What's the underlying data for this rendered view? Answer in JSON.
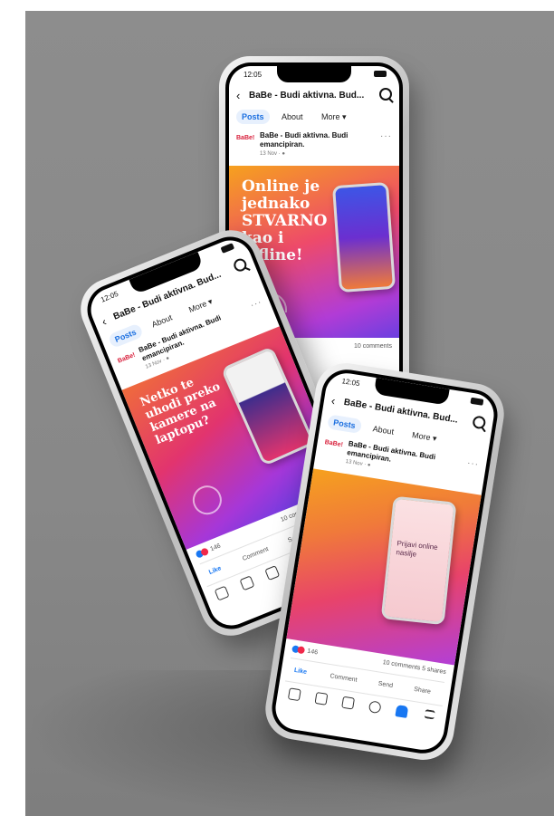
{
  "status": {
    "time": "12:05"
  },
  "page_name": "BaBe - Budi aktivna. Bud...",
  "tabs": [
    "Posts",
    "About",
    "More ▾"
  ],
  "post": {
    "author": "BaBe - Budi aktivna. Budi emancipiran.",
    "logo_text": "BaBe!",
    "meta": "13 Nov · ●"
  },
  "creatives": {
    "back": "Online je jednako STVARNO kao i offline!",
    "left": "Netko te uhodi preko kamere na laptopu?",
    "right_mini": "Prijavi online nasilje"
  },
  "reactions": {
    "count": "146",
    "comments": "10 comments",
    "shares": "5 shares"
  },
  "actions": {
    "like": "Like",
    "comment": "Comment",
    "send": "Send",
    "share": "Share"
  },
  "icons": {
    "back": "chevron-left-icon",
    "search": "search-icon",
    "more": "more-dots-icon",
    "wifi": "wifi-icon",
    "nav": [
      "home-icon",
      "video-icon",
      "marketplace-icon",
      "profile-icon",
      "bell-icon",
      "menu-icon"
    ]
  },
  "colors": {
    "background": "#888888",
    "accent": "#1877f2",
    "gradient_start": "#f6a11e",
    "gradient_mid": "#ee4a6a",
    "gradient_end": "#6b3fe0",
    "brand": "#d81e3a"
  }
}
